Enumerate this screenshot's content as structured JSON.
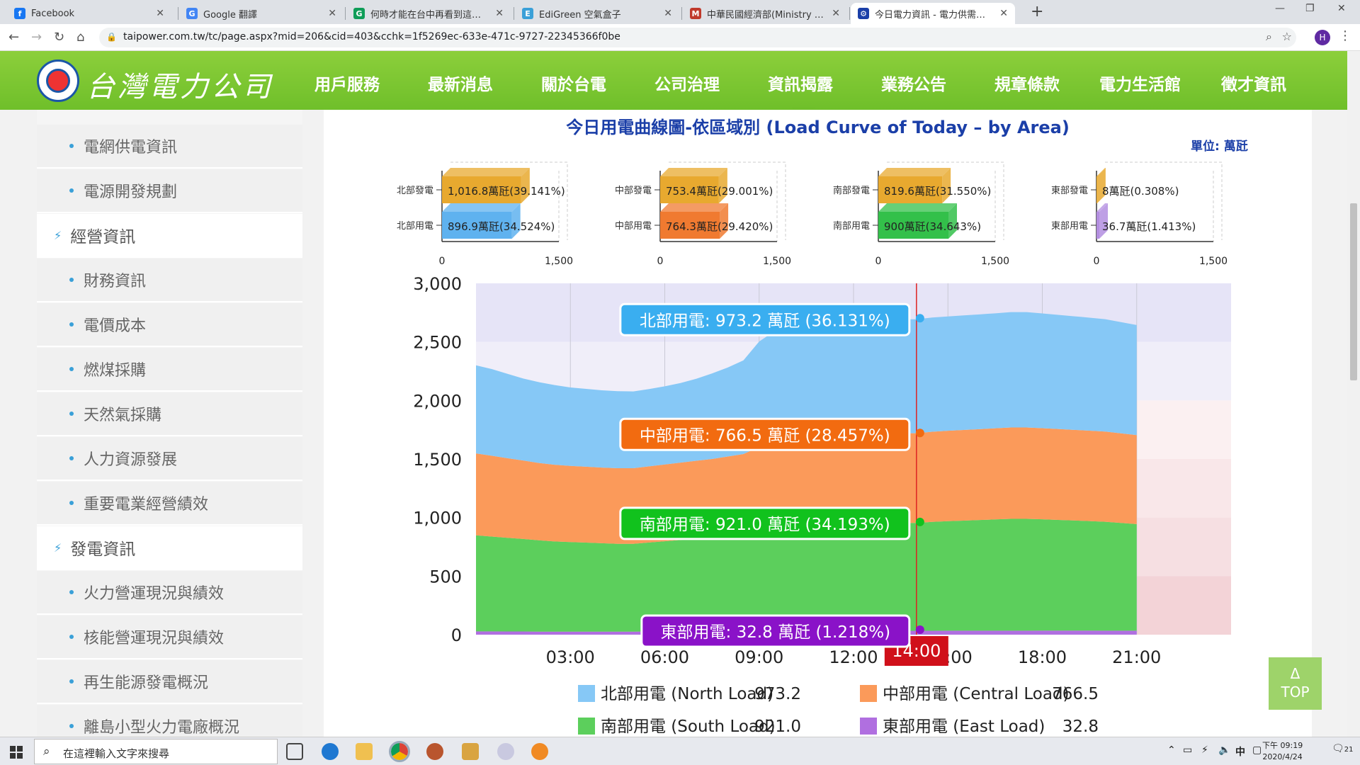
{
  "browser": {
    "tabs": [
      {
        "title": "Facebook",
        "icon_color": "#1877f2",
        "icon_glyph": "f"
      },
      {
        "title": "Google 翻譯",
        "icon_color": "#4285f4",
        "icon_glyph": "G"
      },
      {
        "title": "何時才能在台中再看到這樣的藍…",
        "icon_color": "#0f9d58",
        "icon_glyph": "G"
      },
      {
        "title": "EdiGreen 空氣盒子",
        "icon_color": "#3aa0d8",
        "icon_glyph": "E"
      },
      {
        "title": "中華民國經濟部(Ministry of Eco…",
        "icon_color": "#c0392b",
        "icon_glyph": "M"
      },
      {
        "title": "今日電力資訊 - 電力供需資訊 - …",
        "icon_color": "#1b3fa8",
        "icon_glyph": "⚙"
      }
    ],
    "url": "taipower.com.tw/tc/page.aspx?mid=206&cid=403&cchk=1f5269ec-633e-471c-9727-22345366f0be",
    "avatar_letter": "H"
  },
  "site": {
    "logo_text": "台灣電力公司",
    "nav": [
      "用戶服務",
      "最新消息",
      "關於台電",
      "公司治理",
      "資訊揭露",
      "業務公告",
      "規章條款",
      "電力生活館",
      "徵才資訊"
    ]
  },
  "sidebar": {
    "items": [
      {
        "kind": "sub",
        "label": "電網供電資訊"
      },
      {
        "kind": "sub",
        "label": "電源開發規劃"
      },
      {
        "kind": "cat",
        "label": "經營資訊"
      },
      {
        "kind": "sub",
        "label": "財務資訊"
      },
      {
        "kind": "sub",
        "label": "電價成本"
      },
      {
        "kind": "sub",
        "label": "燃煤採購"
      },
      {
        "kind": "sub",
        "label": "天然氣採購"
      },
      {
        "kind": "sub",
        "label": "人力資源發展"
      },
      {
        "kind": "sub",
        "label": "重要電業經營績效"
      },
      {
        "kind": "cat",
        "label": "發電資訊"
      },
      {
        "kind": "sub",
        "label": "火力營運現況與績效"
      },
      {
        "kind": "sub",
        "label": "核能營運現況與績效"
      },
      {
        "kind": "sub",
        "label": "再生能源發電概況"
      },
      {
        "kind": "sub",
        "label": "離島小型火力電廠概況"
      }
    ]
  },
  "page": {
    "title": "今日用電曲線圖-依區域別 (Load Curve of Today – by Area)",
    "unit": "單位: 萬瓩",
    "top_button": [
      "Δ",
      "TOP"
    ]
  },
  "chart_data": [
    {
      "type": "bar",
      "region": "north",
      "categories": [
        "北部發電",
        "北部用電"
      ],
      "values": [
        1016.8,
        896.9
      ],
      "labels": [
        "1,016.8萬瓩(39.141%)",
        "896.9萬瓩(34.524%)"
      ],
      "colors": [
        "#e8a92f",
        "#5fb2ef"
      ],
      "xlim": [
        0,
        1500
      ],
      "xticks": [
        "0",
        "1,500"
      ]
    },
    {
      "type": "bar",
      "region": "central",
      "categories": [
        "中部發電",
        "中部用電"
      ],
      "values": [
        753.4,
        764.3
      ],
      "labels": [
        "753.4萬瓩(29.001%)",
        "764.3萬瓩(29.420%)"
      ],
      "colors": [
        "#e8a92f",
        "#f07a30"
      ],
      "xlim": [
        0,
        1500
      ],
      "xticks": [
        "0",
        "1,500"
      ]
    },
    {
      "type": "bar",
      "region": "south",
      "categories": [
        "南部發電",
        "南部用電"
      ],
      "values": [
        819.6,
        900
      ],
      "labels": [
        "819.6萬瓩(31.550%)",
        "900萬瓩(34.643%)"
      ],
      "colors": [
        "#e8a92f",
        "#33c04a"
      ],
      "xlim": [
        0,
        1500
      ],
      "xticks": [
        "0",
        "1,500"
      ]
    },
    {
      "type": "bar",
      "region": "east",
      "categories": [
        "東部發電",
        "東部用電"
      ],
      "values": [
        8,
        36.7
      ],
      "labels": [
        "8萬瓩(0.308%)",
        "36.7萬瓩(1.413%)"
      ],
      "colors": [
        "#e8a92f",
        "#b38ee0"
      ],
      "xlim": [
        0,
        1500
      ],
      "xticks": [
        "0",
        "1,500"
      ]
    },
    {
      "type": "area",
      "stacked": true,
      "x_hours": [
        0,
        0.5,
        1,
        1.5,
        2,
        2.5,
        3,
        3.5,
        4,
        4.5,
        5,
        5.5,
        6,
        6.5,
        7,
        7.5,
        8,
        8.5,
        9,
        9.5,
        10,
        10.5,
        11,
        11.5,
        12,
        12.5,
        13,
        13.5,
        14,
        14.5,
        15,
        15.5,
        16,
        16.5,
        17,
        17.5,
        18,
        18.5,
        19,
        19.5,
        20,
        20.5,
        21
      ],
      "xlim": [
        0,
        24
      ],
      "ylim": [
        0,
        3000
      ],
      "yticks": [
        "0",
        "500",
        "1,000",
        "1,500",
        "2,000",
        "2,500",
        "3,000"
      ],
      "xticks": [
        {
          "h": 3,
          "label": "03:00"
        },
        {
          "h": 6,
          "label": "06:00"
        },
        {
          "h": 9,
          "label": "09:00"
        },
        {
          "h": 12,
          "label": "12:00"
        },
        {
          "h": 15,
          "label": "15:00"
        },
        {
          "h": 18,
          "label": "18:00"
        },
        {
          "h": 21,
          "label": "21:00"
        }
      ],
      "series": [
        {
          "name": "東部用電 (East Load)",
          "color": "#b06fe0",
          "values": [
            28,
            28,
            27,
            27,
            26,
            26,
            26,
            26,
            26,
            26,
            26,
            27,
            28,
            29,
            30,
            30,
            31,
            32,
            33,
            33,
            33,
            33,
            33,
            33,
            33,
            33,
            33,
            33,
            33,
            33,
            34,
            34,
            34,
            34,
            34,
            34,
            35,
            35,
            35,
            35,
            34,
            34,
            34
          ]
        },
        {
          "name": "南部用電 (South Load)",
          "color": "#5ccf5c",
          "values": [
            820,
            810,
            800,
            790,
            780,
            770,
            765,
            760,
            755,
            750,
            750,
            760,
            770,
            780,
            790,
            800,
            810,
            820,
            850,
            880,
            900,
            910,
            915,
            918,
            920,
            921,
            921,
            921,
            921,
            930,
            935,
            940,
            945,
            950,
            955,
            955,
            950,
            945,
            940,
            935,
            930,
            920,
            910
          ]
        },
        {
          "name": "中部用電 (Central Load)",
          "color": "#fb9a5a",
          "values": [
            700,
            690,
            680,
            670,
            660,
            655,
            650,
            648,
            646,
            645,
            645,
            650,
            655,
            660,
            665,
            670,
            680,
            690,
            720,
            740,
            750,
            755,
            760,
            762,
            764,
            765,
            766,
            766,
            766,
            770,
            772,
            774,
            776,
            778,
            780,
            780,
            778,
            776,
            774,
            772,
            770,
            765,
            760
          ]
        },
        {
          "name": "北部用電 (North Load)",
          "color": "#86c8f6",
          "values": [
            752,
            740,
            720,
            700,
            690,
            680,
            670,
            665,
            660,
            658,
            656,
            660,
            668,
            680,
            700,
            730,
            760,
            800,
            900,
            940,
            960,
            965,
            968,
            970,
            972,
            973,
            973,
            973,
            973,
            975,
            976,
            978,
            980,
            982,
            985,
            985,
            980,
            975,
            970,
            965,
            960,
            950,
            940
          ]
        }
      ],
      "cursor": {
        "h": 14,
        "label": "14:00"
      },
      "tooltips": [
        {
          "text": "北部用電: 973.2 萬瓩 (36.131%)",
          "color": "#3aaef0",
          "y": 2690
        },
        {
          "text": "中部用電: 766.5 萬瓩 (28.457%)",
          "color": "#f26b10",
          "y": 1710
        },
        {
          "text": "南部用電: 921.0 萬瓩 (34.193%)",
          "color": "#11c21d",
          "y": 950
        },
        {
          "text": "東部用電: 32.8 萬瓩 (1.218%)",
          "color": "#8a12c8",
          "y": 30
        }
      ],
      "legend": [
        {
          "label": "北部用電 (North Load)",
          "value": "973.2",
          "color": "#86c8f6"
        },
        {
          "label": "中部用電 (Central Load)",
          "value": "766.5",
          "color": "#fb9a5a"
        },
        {
          "label": "南部用電 (South Load)",
          "value": "921.0",
          "color": "#5ccf5c"
        },
        {
          "label": "東部用電 (East Load)",
          "value": "32.8",
          "color": "#b06fe0"
        }
      ]
    }
  ],
  "taskbar": {
    "search_placeholder": "在這裡輸入文字來搜尋",
    "tray_ime": "中",
    "clock_time": "下午 09:19",
    "clock_date": "2020/4/24",
    "notif_count": "21"
  }
}
